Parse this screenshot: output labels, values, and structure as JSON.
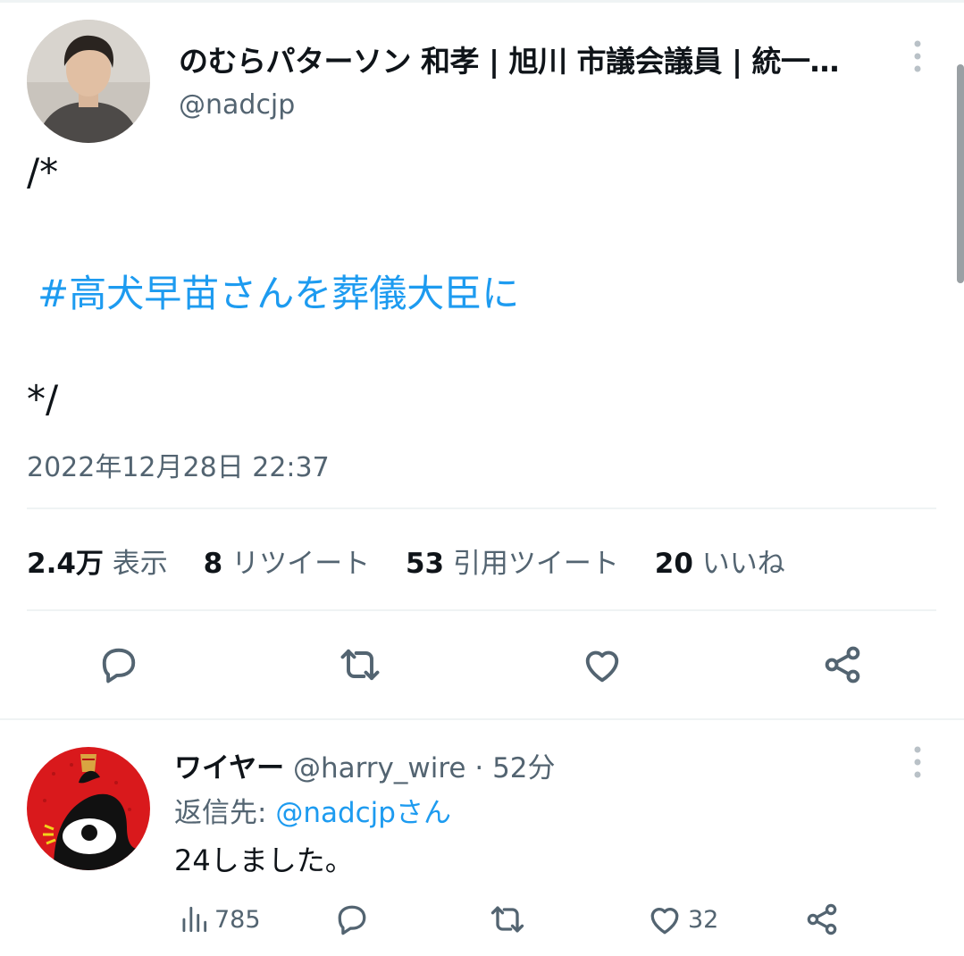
{
  "tweet": {
    "author_name": "のむらパターソン 和孝 | 旭川 市議会議員 | 統一…",
    "author_handle": "@nadcjp",
    "line1": "/*",
    "hashtag": "#高犬早苗さんを葬儀大臣に",
    "line3": "*/",
    "timestamp": "2022年12月28日 22:37"
  },
  "stats": {
    "views_num": "2.4万",
    "views_label": "表示",
    "retweets_num": "8",
    "retweets_label": "リツイート",
    "quotes_num": "53",
    "quotes_label": "引用ツイート",
    "likes_num": "20",
    "likes_label": "いいね"
  },
  "actions": [
    "reply-icon",
    "retweet-icon",
    "like-icon",
    "share-icon"
  ],
  "reply": {
    "name": "ワイヤー",
    "handle": "@harry_wire",
    "separator": "·",
    "time": "52分",
    "reply_to_label": "返信先:",
    "reply_to_mention": "@nadcjpさん",
    "text": "24しました。",
    "views": "785",
    "likes": "32"
  },
  "colors": {
    "accent": "#1d9bf0",
    "text": "#0f1419",
    "secondary": "#536471",
    "divider": "#eff3f4"
  }
}
